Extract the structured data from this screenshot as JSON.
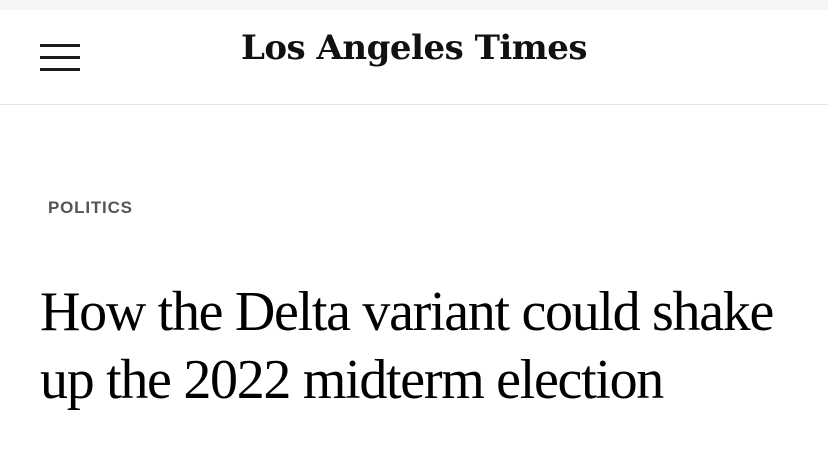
{
  "header": {
    "logo_text": "Los Angeles Times",
    "menu_icon": "hamburger-menu-icon"
  },
  "article": {
    "section": "POLITICS",
    "headline": "How the Delta variant could shake up the 2022 midterm election"
  },
  "colors": {
    "header_border": "#e4e4e4",
    "section_text": "#555555",
    "headline_text": "#000000"
  }
}
